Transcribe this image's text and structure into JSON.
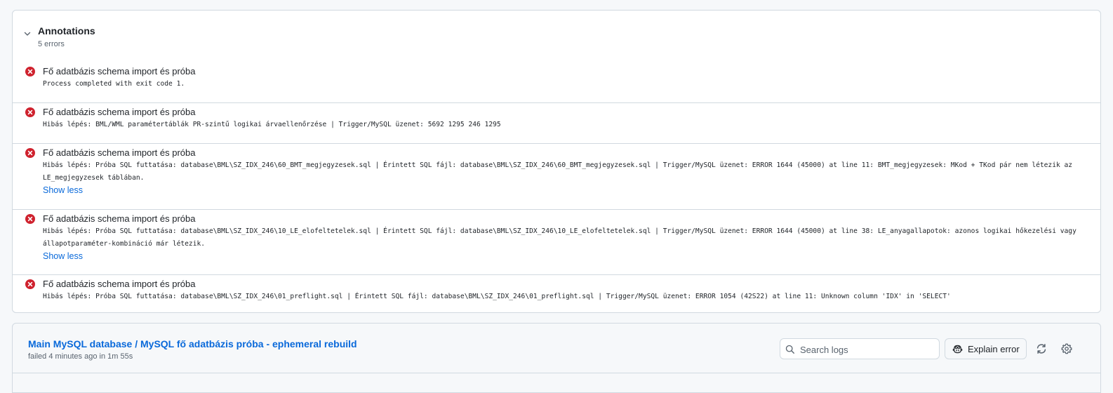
{
  "annotations": {
    "title": "Annotations",
    "count": "5 errors",
    "items": [
      {
        "title": "Fő adatbázis schema import és próba",
        "message": "Process completed with exit code 1.",
        "show_less": ""
      },
      {
        "title": "Fő adatbázis schema import és próba",
        "message": "Hibás lépés: BML/WML paramétertáblák PR-szintű logikai árvaellenőrzése | Trigger/MySQL üzenet: 5692 1295 246 1295",
        "show_less": ""
      },
      {
        "title": "Fő adatbázis schema import és próba",
        "message": "Hibás lépés: Próba SQL futtatása: database\\BML\\SZ_IDX_246\\60_BMT_megjegyzesek.sql | Érintett SQL fájl: database\\BML\\SZ_IDX_246\\60_BMT_megjegyzesek.sql | Trigger/MySQL üzenet: ERROR 1644 (45000) at line 11: BMT_megjegyzesek: MKod + TKod pár nem létezik az LE_megjegyzesek táblában.",
        "show_less": "Show less"
      },
      {
        "title": "Fő adatbázis schema import és próba",
        "message": "Hibás lépés: Próba SQL futtatása: database\\BML\\SZ_IDX_246\\10_LE_elofeltetelek.sql | Érintett SQL fájl: database\\BML\\SZ_IDX_246\\10_LE_elofeltetelek.sql | Trigger/MySQL üzenet: ERROR 1644 (45000) at line 38: LE_anyagallapotok: azonos logikai hőkezelési vagy állapotparaméter-kombináció már létezik.",
        "show_less": "Show less"
      },
      {
        "title": "Fő adatbázis schema import és próba",
        "message": "Hibás lépés: Próba SQL futtatása: database\\BML\\SZ_IDX_246\\01_preflight.sql | Érintett SQL fájl: database\\BML\\SZ_IDX_246\\01_preflight.sql | Trigger/MySQL üzenet: ERROR 1054 (42S22) at line 11: Unknown column 'IDX' in 'SELECT'",
        "show_less": ""
      }
    ]
  },
  "job": {
    "title": "Main MySQL database / MySQL fő adatbázis próba - ephemeral rebuild",
    "status": "failed 4 minutes ago in 1m 55s",
    "search_placeholder": "Search logs",
    "explain_label": "Explain error"
  },
  "icons": {
    "collapse": "chevron-down-icon",
    "error": "x-circle-fill-icon",
    "search": "search-icon",
    "copilot": "copilot-icon",
    "refresh": "sync-icon",
    "settings": "gear-icon"
  },
  "colors": {
    "error": "#cf222e",
    "link": "#0969da",
    "border": "#d1d9e0"
  }
}
